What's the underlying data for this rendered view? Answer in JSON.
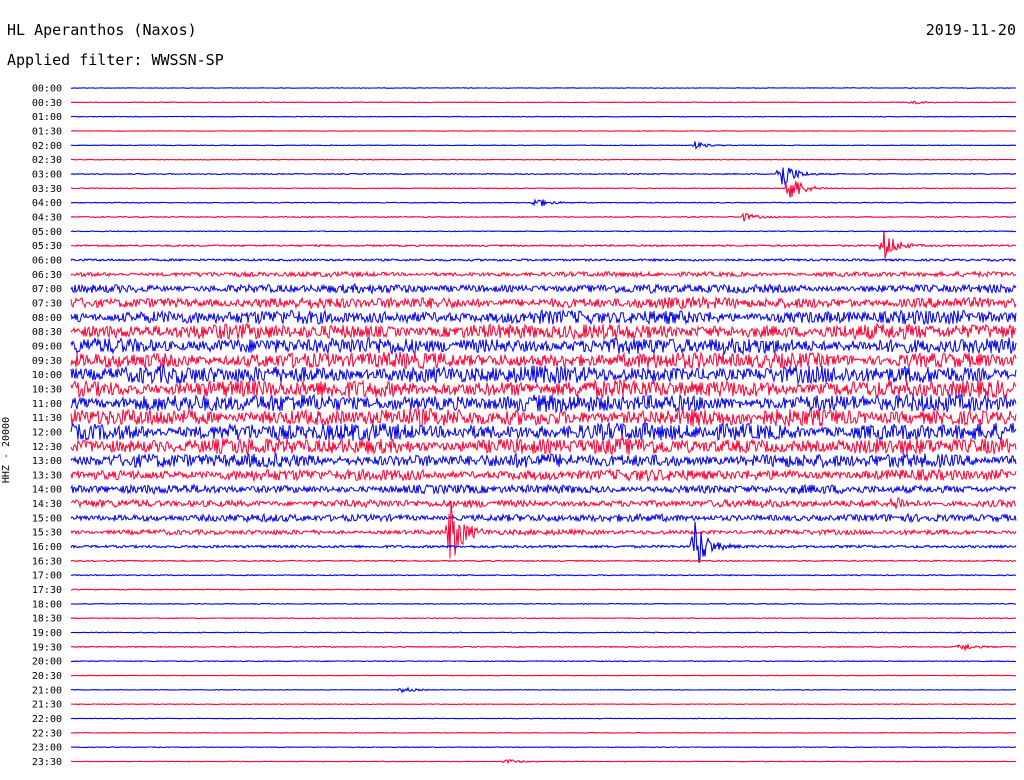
{
  "header": {
    "station": "HL Aperanthos (Naxos)",
    "date": "2019-11-20",
    "filter": "Applied filter: WWSSN-SP"
  },
  "chart_data": {
    "type": "line",
    "title": "HL Aperanthos (Naxos)",
    "ylabel": "HHZ - 20000",
    "xlabel": "",
    "colors": {
      "odd_rows": "#0000ee",
      "even_rows": "#ff0033"
    },
    "rows": [
      {
        "label": "00:00",
        "amp": 0.3
      },
      {
        "label": "00:30",
        "amp": 0.3
      },
      {
        "label": "01:00",
        "amp": 0.3
      },
      {
        "label": "01:30",
        "amp": 0.3
      },
      {
        "label": "02:00",
        "amp": 0.3
      },
      {
        "label": "02:30",
        "amp": 0.3
      },
      {
        "label": "03:00",
        "amp": 0.5
      },
      {
        "label": "03:30",
        "amp": 0.4
      },
      {
        "label": "04:00",
        "amp": 0.4
      },
      {
        "label": "04:30",
        "amp": 0.5
      },
      {
        "label": "05:00",
        "amp": 0.4
      },
      {
        "label": "05:30",
        "amp": 0.8
      },
      {
        "label": "06:00",
        "amp": 1.0
      },
      {
        "label": "06:30",
        "amp": 2.0
      },
      {
        "label": "07:00",
        "amp": 3.5
      },
      {
        "label": "07:30",
        "amp": 4.5
      },
      {
        "label": "08:00",
        "amp": 5.5
      },
      {
        "label": "08:30",
        "amp": 6.0
      },
      {
        "label": "09:00",
        "amp": 6.5
      },
      {
        "label": "09:30",
        "amp": 6.5
      },
      {
        "label": "10:00",
        "amp": 7.0
      },
      {
        "label": "10:30",
        "amp": 7.0
      },
      {
        "label": "11:00",
        "amp": 7.0
      },
      {
        "label": "11:30",
        "amp": 7.0
      },
      {
        "label": "12:00",
        "amp": 7.0
      },
      {
        "label": "12:30",
        "amp": 6.5
      },
      {
        "label": "13:00",
        "amp": 5.5
      },
      {
        "label": "13:30",
        "amp": 4.5
      },
      {
        "label": "14:00",
        "amp": 3.5
      },
      {
        "label": "14:30",
        "amp": 3.0
      },
      {
        "label": "15:00",
        "amp": 3.0
      },
      {
        "label": "15:30",
        "amp": 2.0
      },
      {
        "label": "16:00",
        "amp": 1.2
      },
      {
        "label": "16:30",
        "amp": 0.6
      },
      {
        "label": "17:00",
        "amp": 0.5
      },
      {
        "label": "17:30",
        "amp": 0.4
      },
      {
        "label": "18:00",
        "amp": 0.4
      },
      {
        "label": "18:30",
        "amp": 0.4
      },
      {
        "label": "19:00",
        "amp": 0.4
      },
      {
        "label": "19:30",
        "amp": 0.5
      },
      {
        "label": "20:00",
        "amp": 0.4
      },
      {
        "label": "20:30",
        "amp": 0.3
      },
      {
        "label": "21:00",
        "amp": 0.3
      },
      {
        "label": "21:30",
        "amp": 0.3
      },
      {
        "label": "22:00",
        "amp": 0.3
      },
      {
        "label": "22:30",
        "amp": 0.3
      },
      {
        "label": "23:00",
        "amp": 0.3
      },
      {
        "label": "23:30",
        "amp": 0.3
      }
    ],
    "events": [
      {
        "row": "00:30",
        "t": 0.89,
        "amp": 2
      },
      {
        "row": "02:00",
        "t": 0.66,
        "amp": 4
      },
      {
        "row": "03:00",
        "t": 0.75,
        "amp": 20
      },
      {
        "row": "03:30",
        "t": 0.76,
        "amp": 18
      },
      {
        "row": "04:00",
        "t": 0.49,
        "amp": 7
      },
      {
        "row": "04:30",
        "t": 0.71,
        "amp": 5
      },
      {
        "row": "05:30",
        "t": 0.86,
        "amp": 16
      },
      {
        "row": "14:30",
        "t": 0.87,
        "amp": 8
      },
      {
        "row": "15:30",
        "t": 0.4,
        "amp": 40
      },
      {
        "row": "16:00",
        "t": 0.66,
        "amp": 30
      },
      {
        "row": "19:30",
        "t": 0.94,
        "amp": 5
      },
      {
        "row": "21:00",
        "t": 0.35,
        "amp": 3
      },
      {
        "row": "23:30",
        "t": 0.46,
        "amp": 3
      }
    ],
    "grid": false,
    "legend": "none"
  }
}
